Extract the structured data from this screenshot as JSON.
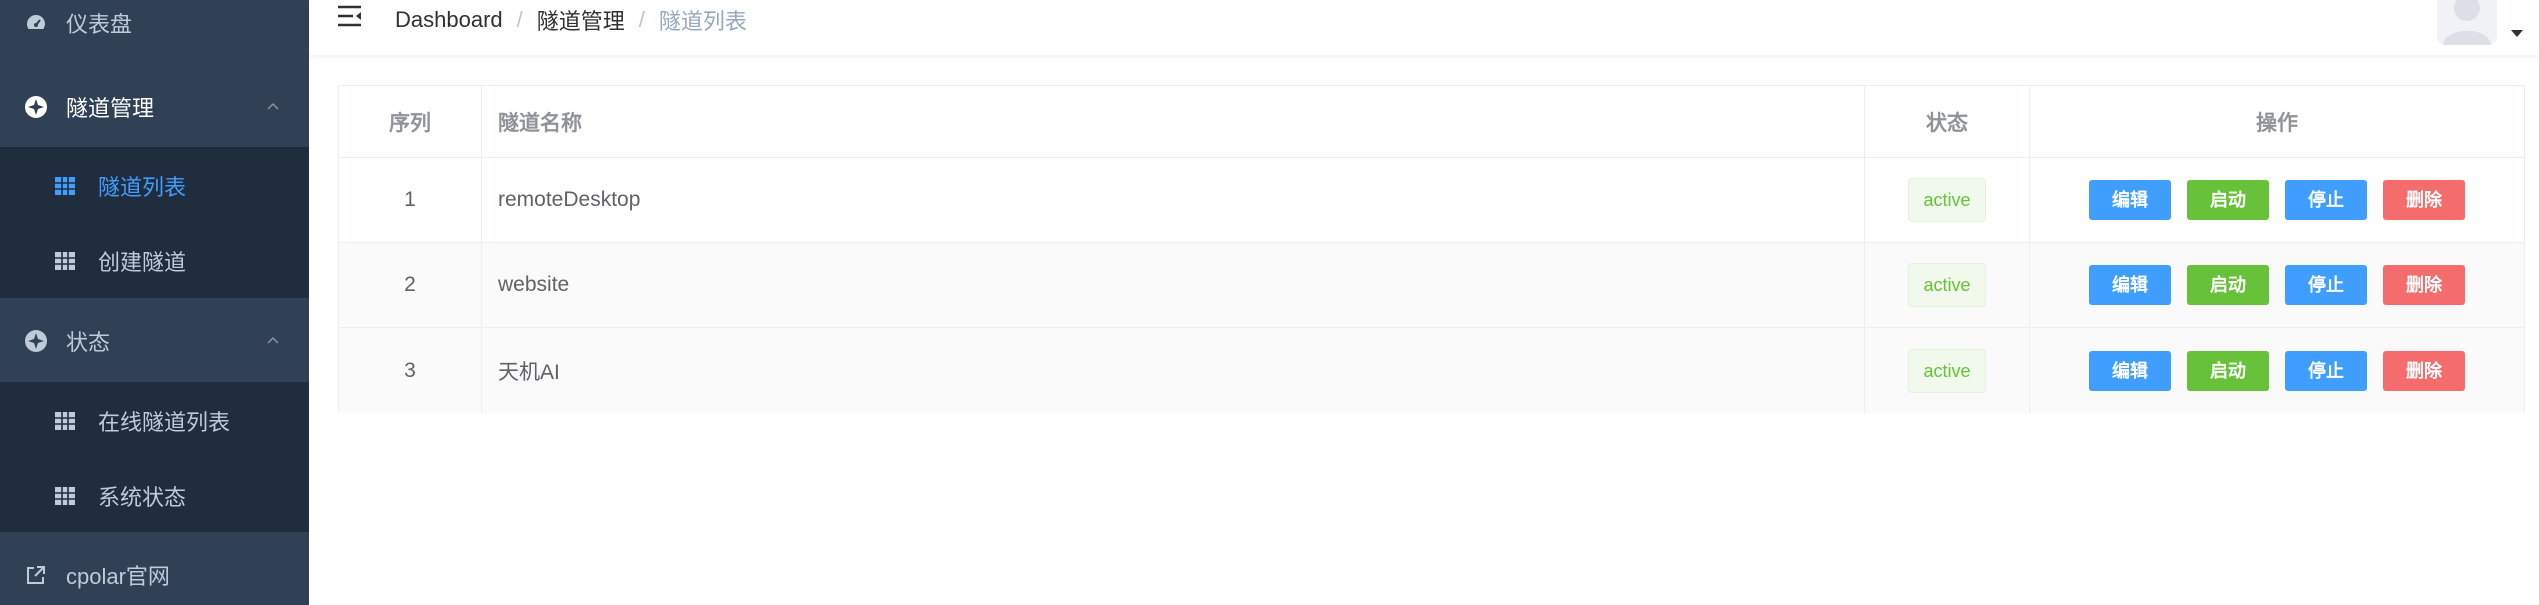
{
  "colors": {
    "sidebar_bg": "#304156",
    "submenu_bg": "#1f2d3d",
    "accent": "#409eff",
    "success": "#67c23a",
    "danger": "#f56c6c"
  },
  "sidebar": {
    "items": [
      {
        "label": "仪表盘",
        "icon": "dashboard-icon"
      },
      {
        "label": "隧道管理",
        "icon": "tunnel-management-icon",
        "expanded": true,
        "children": [
          {
            "label": "隧道列表",
            "icon": "grid-icon",
            "active": true
          },
          {
            "label": "创建隧道",
            "icon": "grid-icon"
          }
        ]
      },
      {
        "label": "状态",
        "icon": "status-icon",
        "expanded": true,
        "children": [
          {
            "label": "在线隧道列表",
            "icon": "grid-icon"
          },
          {
            "label": "系统状态",
            "icon": "grid-icon"
          }
        ]
      },
      {
        "label": "cpolar官网",
        "icon": "external-link-icon"
      }
    ]
  },
  "breadcrumb": {
    "items": [
      "Dashboard",
      "隧道管理",
      "隧道列表"
    ],
    "separator": "/"
  },
  "table": {
    "columns": [
      "序列",
      "隧道名称",
      "状态",
      "操作"
    ],
    "rows": [
      {
        "index": "1",
        "name": "remoteDesktop",
        "status": "active"
      },
      {
        "index": "2",
        "name": "website",
        "status": "active"
      },
      {
        "index": "3",
        "name": "天机AI",
        "status": "active"
      }
    ],
    "actions": {
      "edit": "编辑",
      "start": "启动",
      "stop": "停止",
      "delete": "删除"
    }
  }
}
